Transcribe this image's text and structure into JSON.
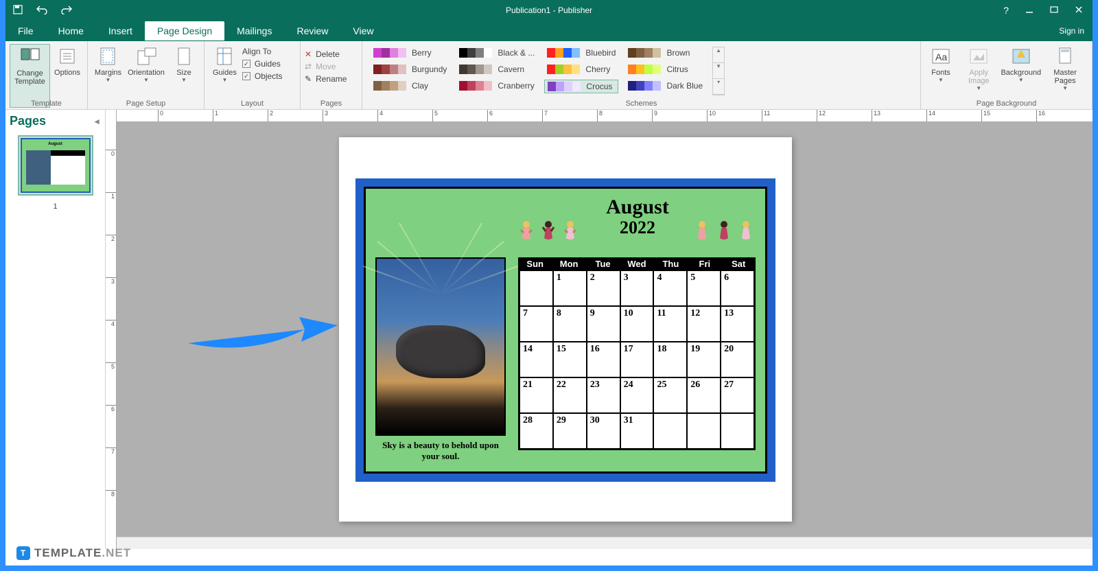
{
  "app": {
    "title": "Publication1 - Publisher",
    "sign_in": "Sign in"
  },
  "menu": {
    "file": "File",
    "home": "Home",
    "insert": "Insert",
    "page_design": "Page Design",
    "mailings": "Mailings",
    "review": "Review",
    "view": "View"
  },
  "ribbon": {
    "template_group": "Template",
    "change_template": "Change Template",
    "options": "Options",
    "page_setup_group": "Page Setup",
    "margins": "Margins",
    "orientation": "Orientation",
    "size": "Size",
    "layout_group": "Layout",
    "guides": "Guides",
    "align_to": "Align To",
    "guides_check": "Guides",
    "objects_check": "Objects",
    "pages_group": "Pages",
    "delete": "Delete",
    "move": "Move",
    "rename": "Rename",
    "schemes_group": "Schemes",
    "page_background_group": "Page Background",
    "fonts": "Fonts",
    "apply_image": "Apply Image",
    "background": "Background",
    "master_pages": "Master Pages"
  },
  "schemes": [
    {
      "name": "Berry",
      "colors": [
        "#d040d0",
        "#a030a0",
        "#e080e0",
        "#f0c0f0"
      ]
    },
    {
      "name": "Burgundy",
      "colors": [
        "#802020",
        "#a04040",
        "#c08080",
        "#e0c0c0"
      ]
    },
    {
      "name": "Clay",
      "colors": [
        "#806040",
        "#a08060",
        "#c0a080",
        "#e0d0c0"
      ]
    },
    {
      "name": "Black & ...",
      "colors": [
        "#000000",
        "#404040",
        "#808080",
        "#ffffff"
      ]
    },
    {
      "name": "Cavern",
      "colors": [
        "#403830",
        "#605850",
        "#a09890",
        "#d0c8c0"
      ]
    },
    {
      "name": "Cranberry",
      "colors": [
        "#a01030",
        "#c04060",
        "#e08090",
        "#f0c0c8"
      ]
    },
    {
      "name": "Bluebird",
      "colors": [
        "#ff2020",
        "#ffa020",
        "#2060ff",
        "#80c0ff"
      ]
    },
    {
      "name": "Cherry",
      "colors": [
        "#ff2020",
        "#a0d020",
        "#ffc040",
        "#ffe080"
      ]
    },
    {
      "name": "Crocus",
      "colors": [
        "#8040c0",
        "#c0a0ff",
        "#e0d0ff",
        "#f0e8ff"
      ],
      "selected": true
    },
    {
      "name": "Brown",
      "colors": [
        "#604020",
        "#806040",
        "#a08060",
        "#d0c0a0"
      ]
    },
    {
      "name": "Citrus",
      "colors": [
        "#ff8020",
        "#ffc020",
        "#c0ff40",
        "#e0ff80"
      ]
    },
    {
      "name": "Dark Blue",
      "colors": [
        "#202080",
        "#4040c0",
        "#8080ff",
        "#c0c0ff"
      ]
    }
  ],
  "pages_panel": {
    "title": "Pages",
    "page_num": "1"
  },
  "calendar": {
    "month": "August",
    "year": "2022",
    "days": [
      "Sun",
      "Mon",
      "Tue",
      "Wed",
      "Thu",
      "Fri",
      "Sat"
    ],
    "weeks": [
      [
        "",
        "1",
        "2",
        "3",
        "4",
        "5",
        "6"
      ],
      [
        "7",
        "8",
        "9",
        "10",
        "11",
        "12",
        "13"
      ],
      [
        "14",
        "15",
        "16",
        "17",
        "18",
        "19",
        "20"
      ],
      [
        "21",
        "22",
        "23",
        "24",
        "25",
        "26",
        "27"
      ],
      [
        "28",
        "29",
        "30",
        "31",
        "",
        "",
        ""
      ]
    ],
    "caption": "Sky is a beauty to behold upon your soul."
  },
  "watermark": {
    "text": "TEMPLATE",
    "suffix": ".NET"
  }
}
